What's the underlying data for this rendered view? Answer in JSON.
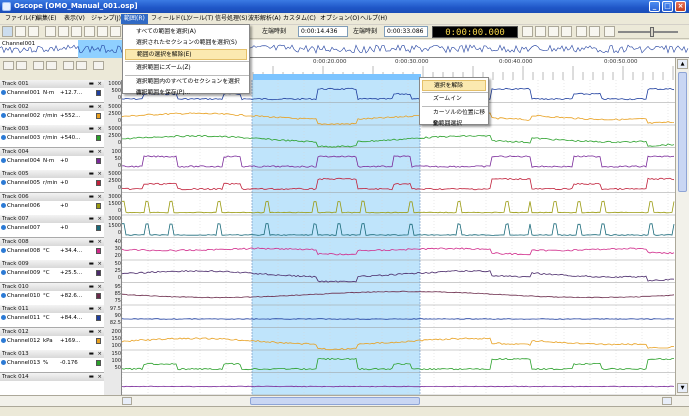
{
  "window": {
    "title": "Oscope [OMO_Manual_001.osp]"
  },
  "menubar": [
    {
      "label": "ファイル(F)",
      "active": false
    },
    {
      "label": "編集(E)",
      "active": false
    },
    {
      "label": "表示(V)",
      "active": false
    },
    {
      "label": "ジャンプ(J)",
      "active": false
    },
    {
      "label": "範囲(R)",
      "active": true
    },
    {
      "label": "フィールド(L)",
      "active": false
    },
    {
      "label": "ツール(T)",
      "active": false
    },
    {
      "label": "信号処理(S)",
      "active": false
    },
    {
      "label": "波形解析(A)",
      "active": false
    },
    {
      "label": "カスタム(C)",
      "active": false
    },
    {
      "label": "オプション(O)",
      "active": false
    },
    {
      "label": "ヘルプ(H)",
      "active": false
    }
  ],
  "toolbar": {
    "left_label": "左端時刻",
    "left_value": "0:00:14.436",
    "width_label": "左端時刻",
    "width_value": "0:00:33.086",
    "timer": "0:00:00.000"
  },
  "overview": {
    "label": "Channel001"
  },
  "ruler_ticks": [
    "0:00:20.000",
    "0:00:30.000",
    "0:00:40.000",
    "0:00:50.000"
  ],
  "range_menu": [
    {
      "label": "すべての範囲を選択(A)",
      "highlight": false
    },
    {
      "label": "選択されたセクションの範囲を選択(S)",
      "highlight": false
    },
    {
      "label": "範囲の選択を解除(E)",
      "highlight": true
    },
    {
      "sep": true
    },
    {
      "label": "選択範囲にズーム(Z)",
      "highlight": false
    },
    {
      "sep": true
    },
    {
      "label": "選択範囲内のすべてのセクションを選択(L)",
      "highlight": false
    },
    {
      "label": "選択範囲を保存(P)...",
      "highlight": false
    }
  ],
  "context_menu": [
    {
      "label": "選択を解除",
      "highlight": true
    },
    {
      "sep": true
    },
    {
      "label": "ズームイン",
      "highlight": false
    },
    {
      "sep": true
    },
    {
      "label": "カーソルの位置に移動",
      "highlight": false
    },
    {
      "label": "全範囲選択",
      "highlight": false
    }
  ],
  "tracks": [
    {
      "name": "Track 001",
      "channel": "Channel001",
      "unit": "N·m",
      "value": "+12.7...",
      "color": "#1f3f9f",
      "y": [
        "1000",
        "500",
        "0"
      ]
    },
    {
      "name": "Track 002",
      "channel": "Channel002",
      "unit": "r/min",
      "value": "+552...",
      "color": "#e8a020",
      "y": [
        "5000",
        "2500",
        "0"
      ]
    },
    {
      "name": "Track 003",
      "channel": "Channel003",
      "unit": "r/min",
      "value": "+540...",
      "color": "#2aa02a",
      "y": [
        "5000",
        "2500",
        "0"
      ]
    },
    {
      "name": "Track 004",
      "channel": "Channel004",
      "unit": "N·m",
      "value": "+0",
      "color": "#7a2a9a",
      "y": [
        "100",
        "50",
        "0"
      ]
    },
    {
      "name": "Track 005",
      "channel": "Channel005",
      "unit": "r/min",
      "value": "+0",
      "color": "#c0203a",
      "y": [
        "5000",
        "2500",
        "0"
      ]
    },
    {
      "name": "Track 006",
      "channel": "Channel006",
      "unit": "",
      "value": "+0",
      "color": "#9a9a10",
      "y": [
        "3000",
        "1500",
        "0"
      ]
    },
    {
      "name": "Track 007",
      "channel": "Channel007",
      "unit": "",
      "value": "+0",
      "color": "#1a6a7a",
      "y": [
        "3000",
        "1500",
        "0"
      ]
    },
    {
      "name": "Track 008",
      "channel": "Channel008",
      "unit": "°C",
      "value": "+34.4...",
      "color": "#d02a8a",
      "y": [
        "40",
        "30",
        "20"
      ]
    },
    {
      "name": "Track 009",
      "channel": "Channel009",
      "unit": "°C",
      "value": "+25.5...",
      "color": "#4a2a6a",
      "y": [
        "50",
        "25",
        "0"
      ]
    },
    {
      "name": "Track 010",
      "channel": "Channel010",
      "unit": "°C",
      "value": "+82.6...",
      "color": "#6a2a4a",
      "y": [
        "95",
        "85",
        "75"
      ]
    },
    {
      "name": "Track 011",
      "channel": "Channel011",
      "unit": "°C",
      "value": "+84.4...",
      "color": "#1f3f9f",
      "y": [
        "97.5",
        "90",
        "82.5"
      ]
    },
    {
      "name": "Track 012",
      "channel": "Channel012",
      "unit": "kPa",
      "value": "+169...",
      "color": "#e8a020",
      "y": [
        "200",
        "150",
        "100"
      ]
    },
    {
      "name": "Track 013",
      "channel": "Channel013",
      "unit": "%",
      "value": "-0.176",
      "color": "#2aa02a",
      "y": [
        "150",
        "100",
        "50"
      ]
    },
    {
      "name": "Track 014",
      "channel": "",
      "unit": "",
      "value": "",
      "color": "#7a2a9a",
      "y": []
    }
  ]
}
